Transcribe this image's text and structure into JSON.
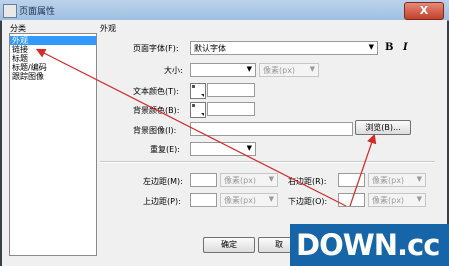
{
  "window": {
    "title": "页面属性",
    "close_glyph": "X"
  },
  "category": {
    "heading": "分类",
    "items": [
      "外观",
      "链接",
      "标题",
      "标题/编码",
      "跟踪图像"
    ],
    "selected": 0
  },
  "panel": {
    "heading": "外观"
  },
  "fields": {
    "page_font": {
      "label": "页面字体(F):",
      "value": "默认字体",
      "bold": "B",
      "italic": "I"
    },
    "size": {
      "label": "大小:",
      "unit": "像素(px)"
    },
    "text_color": {
      "label": "文本颜色(T):"
    },
    "bg_color": {
      "label": "背景颜色(B):"
    },
    "bg_image": {
      "label": "背景图像(I):",
      "browse": "浏览(B)..."
    },
    "repeat": {
      "label": "重复(E):"
    },
    "margin_left": {
      "label": "左边距(M):",
      "unit": "像素(px)"
    },
    "margin_right": {
      "label": "右边距(R):",
      "unit": "像素(px)"
    },
    "margin_top": {
      "label": "上边距(P):",
      "unit": "像素(px)"
    },
    "margin_bottom": {
      "label": "下边距(O):",
      "unit": "像素(px)"
    }
  },
  "buttons": {
    "ok": "确定",
    "cancel": "取"
  },
  "watermark": "DOWN.cc",
  "colors": {
    "selection": "#3399ff",
    "annotation_arrow": "#d42a2a",
    "titlebar": "#a9c8e8",
    "watermark_bg": "#1565a8"
  }
}
